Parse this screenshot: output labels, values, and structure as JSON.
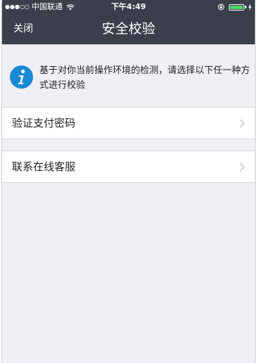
{
  "status_bar": {
    "signal_dots": "●●●○○",
    "carrier": "中国联通",
    "time": "下午4:49",
    "battery_color": "#4cd964",
    "battery_level": 1.0
  },
  "nav": {
    "close_label": "关闭",
    "title": "安全校验"
  },
  "notice": {
    "icon": "info-icon",
    "icon_color": "#1a8ad4",
    "text": "基于对你当前操作环境的检测，请选择以下任一种方式进行校验"
  },
  "options": [
    {
      "label": "验证支付密码",
      "icon": "chevron-right-icon"
    },
    {
      "label": "联系在线客服",
      "icon": "chevron-right-icon"
    }
  ]
}
